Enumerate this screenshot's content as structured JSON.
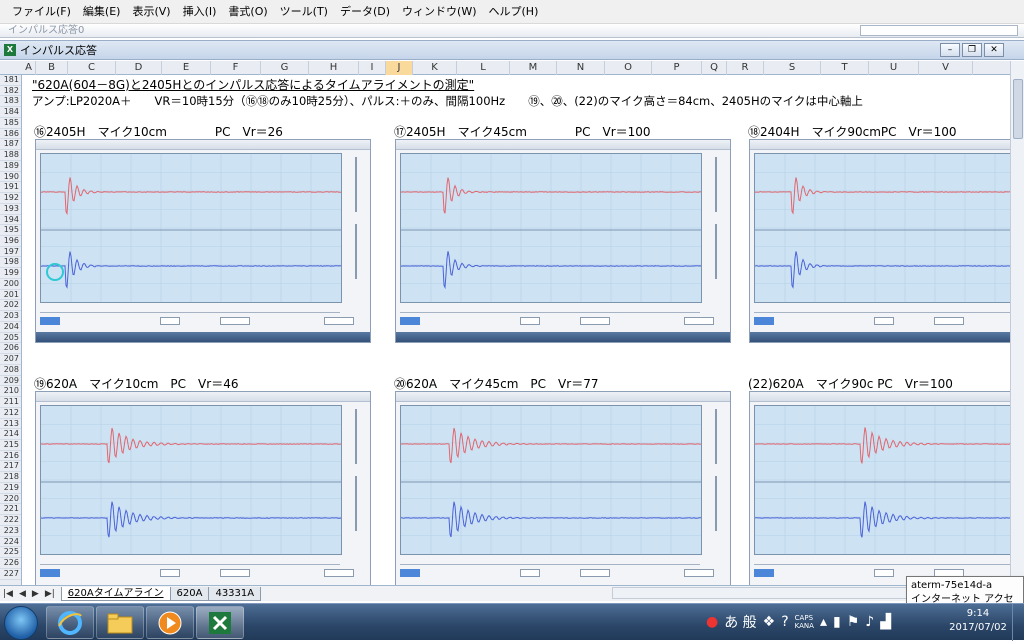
{
  "menu": [
    "ファイル(F)",
    "編集(E)",
    "表示(V)",
    "挿入(I)",
    "書式(O)",
    "ツール(T)",
    "データ(D)",
    "ウィンドウ(W)",
    "ヘルプ(H)"
  ],
  "toolstrip": {
    "ghost_text": "インパルス応答0"
  },
  "window": {
    "title": "インパルス応答",
    "icon": "excel-icon",
    "buttons": [
      "minimize",
      "restore",
      "close"
    ]
  },
  "columns": [
    "A",
    "B",
    "C",
    "D",
    "E",
    "F",
    "G",
    "H",
    "I",
    "J",
    "K",
    "L",
    "M",
    "N",
    "O",
    "P",
    "Q",
    "R",
    "S",
    "T",
    "U",
    "V"
  ],
  "selected_column": "J",
  "rows": [
    "181",
    "182",
    "183",
    "184",
    "185",
    "186",
    "187",
    "188",
    "189",
    "190",
    "191",
    "192",
    "193",
    "194",
    "195",
    "196",
    "197",
    "198",
    "199",
    "200",
    "201",
    "202",
    "203",
    "204",
    "205",
    "206",
    "207",
    "208",
    "209",
    "210",
    "211",
    "212",
    "213",
    "214",
    "215",
    "216",
    "217",
    "218",
    "219",
    "220",
    "221",
    "222",
    "223",
    "224",
    "225",
    "226",
    "227"
  ],
  "sheet": {
    "heading": "\"620A(604－8G)と2405Hとのインパルス応答によるタイムアライメントの測定\"",
    "subheading": "アンプ:LP2020A＋　　VR＝10時15分（⑯⑱のみ10時25分）、パルス:＋のみ、間隔100Hz　　⑲、⑳、(22)のマイク高さ＝84cm、2405Hのマイクは中心軸上",
    "panels": [
      {
        "title": "⑯2405H　マイク10cm　　　　PC　Vr＝26",
        "spike": 0.08
      },
      {
        "title": "⑰2405H　マイク45cm　　　　PC　Vr＝100",
        "spike": 0.14
      },
      {
        "title": "⑱2404H　マイク90cmPC　Vr＝100",
        "spike": 0.12
      },
      {
        "title": "⑲620A　マイク10cm　PC　Vr＝46",
        "spike": 0.22
      },
      {
        "title": "⑳620A　マイク45cm　PC　Vr＝77",
        "spike": 0.16
      },
      {
        "title": "(22)620A　マイク90c PC　Vr＝100",
        "spike": 0.35
      }
    ]
  },
  "tabs": [
    {
      "label": "620Aタイムアライン",
      "active": true
    },
    {
      "label": "620A",
      "active": false
    },
    {
      "label": "43331A",
      "active": false
    }
  ],
  "tooltip": {
    "line1": "aterm-75e14d-a",
    "line2": "インターネット アクセス"
  },
  "taskbar": {
    "apps": [
      "internet-explorer-icon",
      "file-explorer-icon",
      "media-player-icon",
      "excel-icon"
    ],
    "ime": "あ 般",
    "caps": "CAPS",
    "kana": "KANA",
    "time": "9:14",
    "date": "2017/07/02"
  },
  "colors": {
    "accent": "#2b4668",
    "plot_bg": "#cde3f4",
    "trace_red": "#e0666e",
    "trace_blue": "#4a62d8",
    "selected_header": "#f9d99c"
  }
}
